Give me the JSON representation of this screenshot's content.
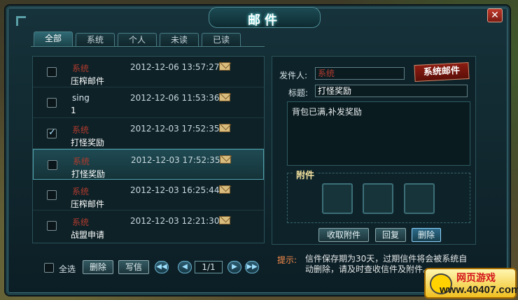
{
  "window": {
    "title": "邮件"
  },
  "tabs": [
    {
      "label": "全部",
      "active": true
    },
    {
      "label": "系统",
      "active": false
    },
    {
      "label": "个人",
      "active": false
    },
    {
      "label": "未读",
      "active": false
    },
    {
      "label": "已读",
      "active": false
    }
  ],
  "mails": [
    {
      "sender": "系统",
      "date": "2012-12-06 13:57:27",
      "subject": "压榨邮件",
      "checked": false,
      "system": true
    },
    {
      "sender": "sing",
      "date": "2012-12-06 11:53:36",
      "subject": "1",
      "checked": false,
      "system": false
    },
    {
      "sender": "系统",
      "date": "2012-12-03 17:52:35",
      "subject": "打怪奖励",
      "checked": true,
      "system": true
    },
    {
      "sender": "系统",
      "date": "2012-12-03 17:52:35",
      "subject": "打怪奖励",
      "checked": false,
      "system": true,
      "selected": true
    },
    {
      "sender": "系统",
      "date": "2012-12-03 16:25:44",
      "subject": "压榨邮件",
      "checked": false,
      "system": true
    },
    {
      "sender": "系统",
      "date": "2012-12-03 12:21:30",
      "subject": "战盟申请",
      "checked": false,
      "system": true
    }
  ],
  "detail": {
    "sender_label": "发件人:",
    "sender_value": "系统",
    "stamp": "系统邮件",
    "title_label": "标题:",
    "title_value": "打怪奖励",
    "body": "背包已满,补发奖励",
    "attachment_label": "附件"
  },
  "detail_buttons": {
    "collect": "收取附件",
    "reply": "回复",
    "delete": "删除"
  },
  "footer": {
    "select_all": "全选",
    "delete": "删除",
    "write": "写信",
    "page": "1/1",
    "hint_label": "提示:",
    "hint_text": "信件保存期为30天，过期信件将会被系统自动删除，请及时查收信件及附件。"
  },
  "watermark": {
    "line1": "网页游戏",
    "line2": "www.40407.com"
  },
  "colors": {
    "system_sender": "#b23b2e",
    "accent": "#4fa0aa",
    "hint": "#ff8f4a"
  }
}
